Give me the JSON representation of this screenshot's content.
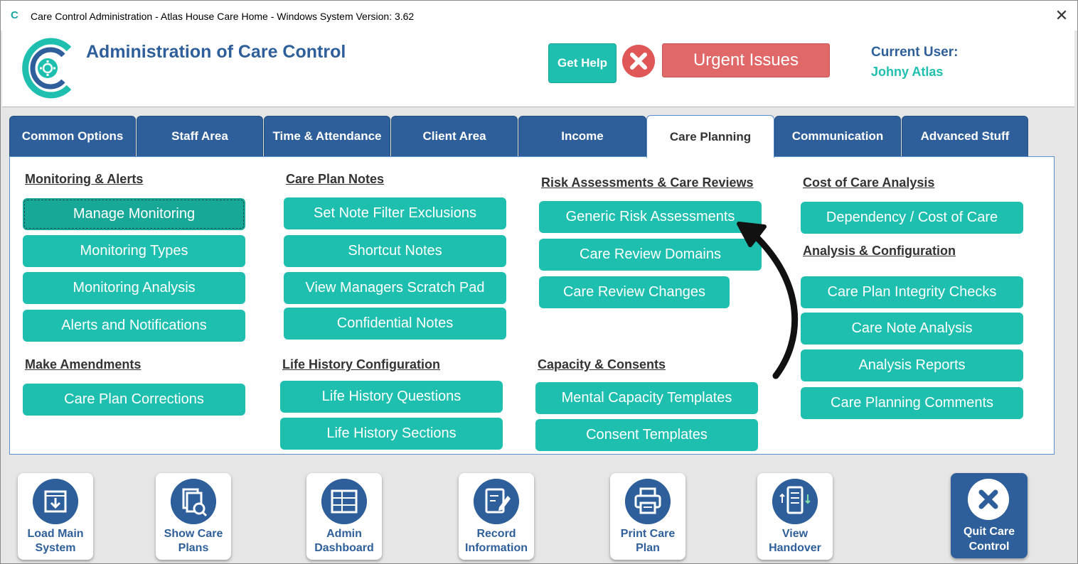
{
  "window": {
    "title": "Care Control Administration - Atlas House Care Home - Windows System Version: 3.62",
    "close_glyph": "✕"
  },
  "header": {
    "app_title": "Administration of Care Control",
    "help_label": "Get Help",
    "urgent_label": "Urgent Issues",
    "user_label": "Current User:",
    "user_name": "Johny Atlas"
  },
  "tabs": [
    {
      "label": "Common Options",
      "active": false
    },
    {
      "label": "Staff Area",
      "active": false
    },
    {
      "label": "Time & Attendance",
      "active": false
    },
    {
      "label": "Client Area",
      "active": false
    },
    {
      "label": "Income",
      "active": false
    },
    {
      "label": "Care Planning",
      "active": true
    },
    {
      "label": "Communication",
      "active": false
    },
    {
      "label": "Advanced Stuff",
      "active": false
    }
  ],
  "sections": {
    "monitoring": {
      "title": "Monitoring & Alerts",
      "buttons": [
        "Manage Monitoring",
        "Monitoring Types",
        "Monitoring Analysis",
        "Alerts and Notifications"
      ]
    },
    "amendments": {
      "title": "Make Amendments",
      "buttons": [
        "Care Plan Corrections"
      ]
    },
    "notes": {
      "title": "Care Plan Notes",
      "buttons": [
        "Set Note Filter Exclusions",
        "Shortcut Notes",
        "View Managers Scratch Pad",
        "Confidential Notes"
      ]
    },
    "life_history": {
      "title": "Life History Configuration",
      "buttons": [
        "Life History Questions",
        "Life History Sections"
      ]
    },
    "risk": {
      "title": "Risk Assessments & Care Reviews",
      "buttons": [
        "Generic Risk Assessments",
        "Care Review Domains",
        "Care Review Changes"
      ]
    },
    "capacity": {
      "title": "Capacity & Consents",
      "buttons": [
        "Mental Capacity Templates",
        "Consent Templates"
      ]
    },
    "cost": {
      "title": "Cost of Care Analysis",
      "buttons": [
        "Dependency / Cost of Care"
      ]
    },
    "analysis": {
      "title": "Analysis & Configuration",
      "buttons": [
        "Care Plan Integrity Checks",
        "Care Note Analysis",
        "Analysis Reports",
        "Care Planning Comments"
      ]
    }
  },
  "toolbar": {
    "load_main": [
      "Load Main",
      "System"
    ],
    "show_plans": [
      "Show Care",
      "Plans"
    ],
    "admin_dash": [
      "Admin",
      "Dashboard"
    ],
    "record_info": [
      "Record",
      "Information"
    ],
    "print_plan": [
      "Print Care",
      "Plan"
    ],
    "view_handover": [
      "View",
      "Handover"
    ],
    "quit": [
      "Quit Care",
      "Control"
    ]
  },
  "colors": {
    "teal": "#1fbfb0",
    "navy": "#2e5f9a",
    "urgent_red": "#e06868"
  }
}
